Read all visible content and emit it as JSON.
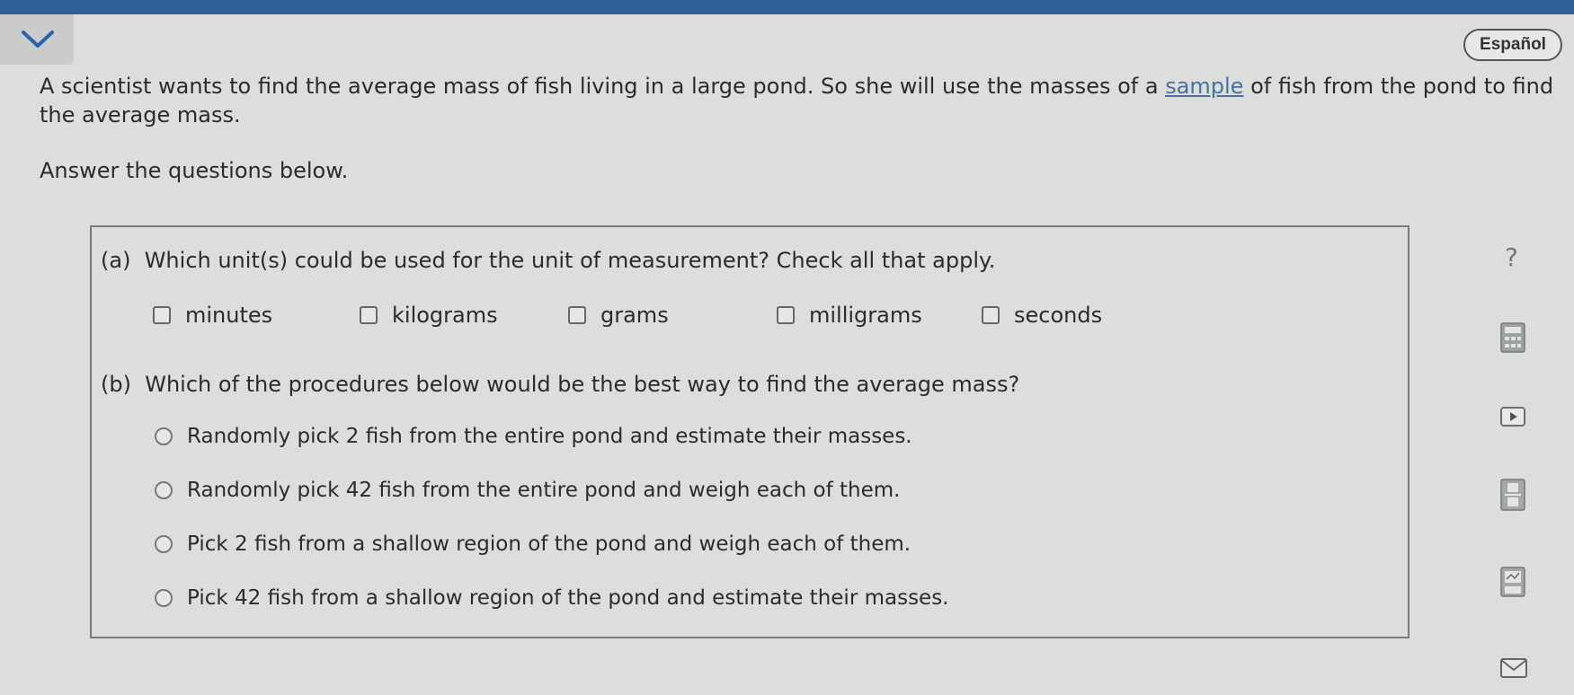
{
  "language_toggle": "Español",
  "intro": {
    "part1": "A scientist wants to find the average mass of fish living in a large pond. So she will use the masses of a ",
    "link": "sample",
    "part2": " of fish from the pond to find the average mass."
  },
  "instructions": "Answer the questions below.",
  "part_a": {
    "label": "(a)",
    "question": "Which unit(s) could be used for the unit of measurement? Check all that apply.",
    "options": [
      "minutes",
      "kilograms",
      "grams",
      "milligrams",
      "seconds"
    ]
  },
  "part_b": {
    "label": "(b)",
    "question": "Which of the procedures below would be the best way to find the average mass?",
    "options": [
      "Randomly pick 2 fish from the entire pond and estimate their masses.",
      "Randomly pick 42 fish from the entire pond and weigh each of them.",
      "Pick 2 fish from a shallow region of the pond and weigh each of them.",
      "Pick 42 fish from a shallow region of the pond and estimate their masses."
    ]
  },
  "tools": {
    "help_symbol": "?",
    "icons": [
      "help-icon",
      "calculator-icon",
      "video-icon",
      "fraction-icon",
      "grapher-icon",
      "mail-icon"
    ]
  }
}
